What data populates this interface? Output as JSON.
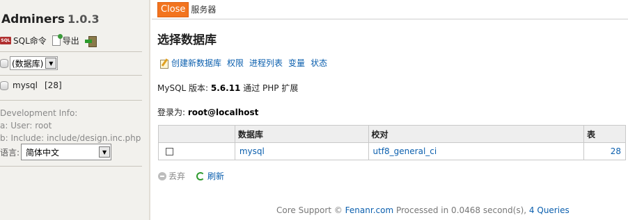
{
  "sidebar": {
    "brand": "Adminers",
    "version": "1.0.3",
    "toolbar": {
      "sql_icon_text": "SQL",
      "sql_label": "SQL命令",
      "export_label": "导出"
    },
    "db_select": {
      "value": "(数据库)"
    },
    "databases": [
      {
        "name": "mysql",
        "count": "[28]"
      }
    ],
    "dev_info": {
      "title": "Development Info:",
      "user": "a: User: root",
      "include": "b: Include: include/design.inc.php"
    },
    "language": {
      "label": "语言:",
      "value": "简体中文"
    }
  },
  "topbar": {
    "close_label": "Close",
    "crumb": "服务器"
  },
  "main": {
    "title": "选择数据库",
    "links": [
      "创建新数据库",
      "权限",
      "进程列表",
      "变量",
      "状态"
    ],
    "version_prefix": "MySQL 版本:",
    "version_value": "5.6.11",
    "version_suffix": "通过 PHP 扩展",
    "login_prefix": "登录为:",
    "login_value": "root@localhost",
    "table": {
      "headers": [
        "",
        "数据库",
        "校对",
        "表"
      ],
      "rows": [
        {
          "database": "mysql",
          "collation": "utf8_general_ci",
          "tables": "28"
        }
      ]
    },
    "actions": {
      "discard": "丢弃",
      "refresh": "刷新"
    }
  },
  "footer": {
    "prefix": "Core Support ©",
    "link": "Fenanr.com",
    "processed": "Processed in 0.0468 second(s),",
    "queries": "4 Queries"
  },
  "colors": {
    "close_bg": "#f2741f",
    "link": "#0b5fae",
    "sidebar_bg": "#f2f1ed"
  }
}
